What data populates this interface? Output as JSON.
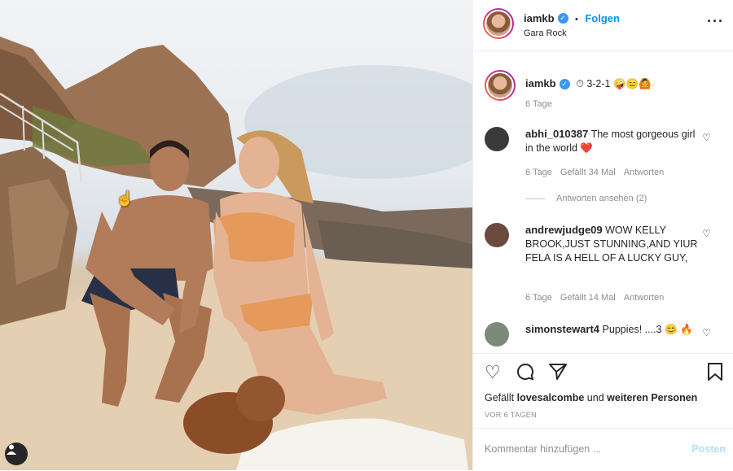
{
  "post": {
    "username": "iamkb",
    "follow_label": "Folgen",
    "location": "Gara Rock",
    "more_icon": "ellipsis-icon"
  },
  "caption": {
    "username": "iamkb",
    "text": "3-2-1",
    "emojis": "🤪😑🙆",
    "age": "6 Tage"
  },
  "comments": [
    {
      "user": "abhi_010387",
      "text": "The most gorgeous girl in the world ❤️",
      "age": "6 Tage",
      "likes": "Gefällt 34 Mal",
      "reply": "Antworten",
      "view_replies": "Antworten ansehen (2)"
    },
    {
      "user": "andrewjudge09",
      "text": "WOW KELLY BROOK,JUST STUNNING,AND YIUR FELA IS A HELL OF A LUCKY GUY,",
      "age": "6 Tage",
      "likes": "Gefällt 14 Mal",
      "reply": "Antworten"
    },
    {
      "user": "simonstewart4",
      "text": "Puppies! ....3 😊 🔥"
    }
  ],
  "likes_prefix": "Gefällt",
  "likes_user": "lovesalcombe",
  "likes_mid": "und",
  "likes_rest": "weiteren Personen",
  "date": "VOR 6 TAGEN",
  "add_comment": {
    "placeholder": "Kommentar hinzufügen ...",
    "post_label": "Posten"
  },
  "colors": {
    "accent": "#0095f6",
    "verified": "#3897f0",
    "muted": "#8e8e8e"
  }
}
